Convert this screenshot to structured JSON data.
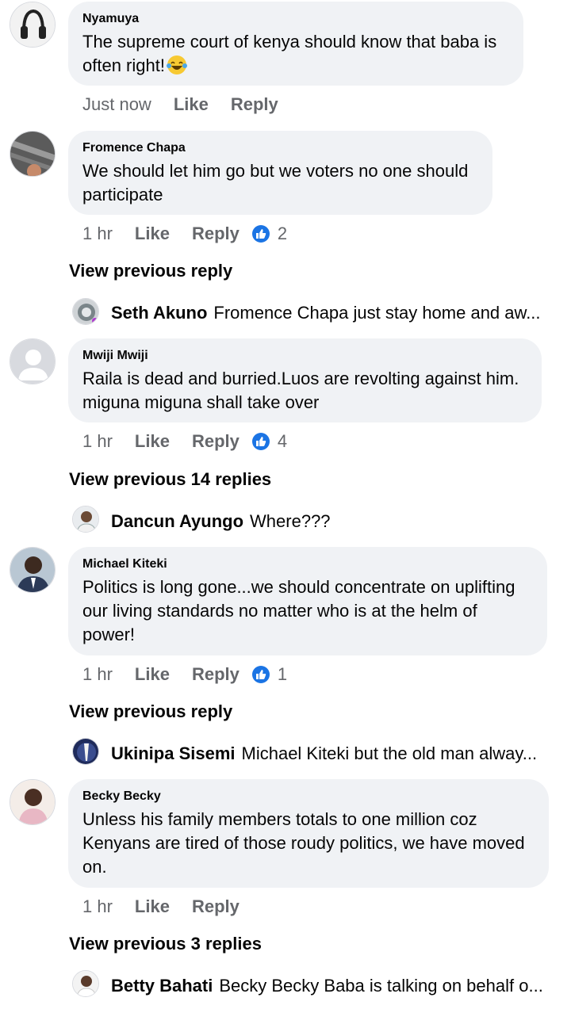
{
  "comments": [
    {
      "author": "Nyamuya",
      "text": "The supreme court of kenya should know that baba is often right!",
      "emoji": "laughing-tears",
      "time": "Just now",
      "like_label": "Like",
      "reply_label": "Reply",
      "reactions": ""
    },
    {
      "author": "Fromence Chapa",
      "text": "We should let him go but we voters no one should participate",
      "time": "1 hr",
      "like_label": "Like",
      "reply_label": "Reply",
      "reactions": "2",
      "view_previous": "View previous reply",
      "reply": {
        "name": "Seth Akuno",
        "text": "Fromence Chapa just stay home and aw..."
      }
    },
    {
      "author": "Mwiji Mwiji",
      "text": "Raila is dead and burried.Luos are revolting against him. miguna miguna shall take over",
      "time": "1 hr",
      "like_label": "Like",
      "reply_label": "Reply",
      "reactions": "4",
      "view_previous": "View previous 14 replies",
      "reply": {
        "name": "Dancun Ayungo",
        "text": "Where???"
      }
    },
    {
      "author": "Michael Kiteki",
      "text": "Politics is long gone...we should concentrate on uplifting our living standards no matter who is at the helm of power!",
      "time": "1 hr",
      "like_label": "Like",
      "reply_label": "Reply",
      "reactions": "1",
      "view_previous": "View previous reply",
      "reply": {
        "name": "Ukinipa Sisemi",
        "text": "Michael Kiteki but the old man alway..."
      }
    },
    {
      "author": "Becky Becky",
      "text": "Unless his family members totals to one million coz Kenyans are tired of those roudy politics, we have moved on.",
      "time": "1 hr",
      "like_label": "Like",
      "reply_label": "Reply",
      "reactions": "",
      "view_previous": "View previous 3 replies",
      "reply": {
        "name": "Betty Bahati",
        "text": "Becky Becky Baba is talking on behalf o..."
      }
    }
  ],
  "colors": {
    "bubble": "#f0f2f5",
    "meta_text": "#65676b",
    "like_blue": "#1b74e4"
  }
}
